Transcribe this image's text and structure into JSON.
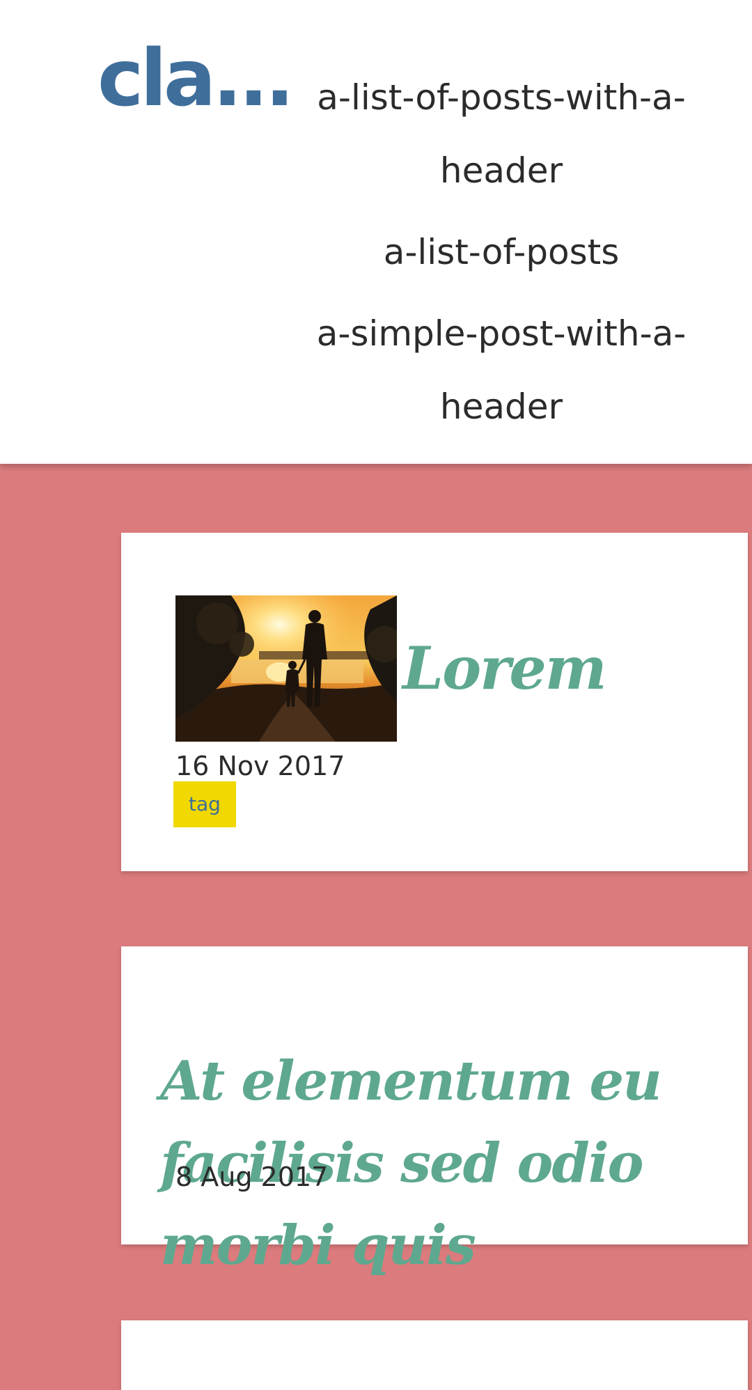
{
  "header": {
    "site_title": "cla...",
    "nav": [
      {
        "label": "a-list-of-posts-with-a-header"
      },
      {
        "label": "a-list-of-posts"
      },
      {
        "label": "a-simple-post-with-a-header"
      }
    ]
  },
  "posts": [
    {
      "title": "Lorem",
      "date": "16 Nov 2017",
      "tag": "tag",
      "has_thumbnail": true
    },
    {
      "title": "At elementum eu facilisis sed odio morbi quis",
      "date": "8 Aug 2017"
    }
  ],
  "colors": {
    "page_background": "#db7b7d",
    "site_title": "#3f6e9b",
    "post_title": "#5ea88f",
    "tag_background": "#f0d800",
    "tag_text": "#3f6e9b"
  }
}
